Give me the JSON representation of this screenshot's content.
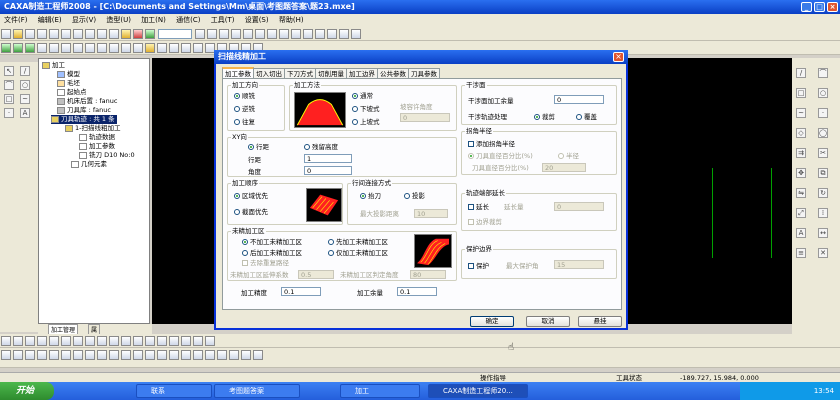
{
  "app": {
    "title": "CAXA制造工程师2008 - [C:\\Documents and Settings\\Mm\\桌面\\考图题答案\\题23.mxe]"
  },
  "menu": [
    "文件(F)",
    "编辑(E)",
    "显示(V)",
    "造型(U)",
    "加工(N)",
    "通信(C)",
    "工具(T)",
    "设置(S)",
    "帮助(H)"
  ],
  "tree": {
    "items": [
      "加工",
      "模型",
      "毛坯",
      "起始点",
      "机床后置 : fanuc",
      "刀具库 : fanuc",
      "刀具轨迹 : 共 1 条",
      "1-扫描线粗加工",
      "轨迹数据",
      "加工参数",
      "铣刀 D10 No:0",
      "几何元素"
    ]
  },
  "bottom_tabs": [
    "加工管理",
    "属"
  ],
  "status": {
    "prompt": "操作指导",
    "tool_state": "工具状态",
    "coords": "-189.727, 15.984, 0.000"
  },
  "taskbar": {
    "start": "开始",
    "tasks": [
      "联系",
      "考图题答案",
      "加工",
      "CAXA制造工程师20..."
    ],
    "clock": "13:54"
  },
  "dialog": {
    "title": "扫描线精加工",
    "tabs": [
      "加工参数",
      "切入切出",
      "下刀方式",
      "切削用量",
      "加工边界",
      "公共参数",
      "刀具参数"
    ],
    "machining_direction": {
      "title": "加工方向",
      "options": [
        "顺铣",
        "逆铣",
        "往复"
      ]
    },
    "machining_method": {
      "title": "加工方法",
      "options": [
        "通常",
        "下坡式",
        "上坡式"
      ],
      "slope_angle_label": "坡容许角度",
      "slope_angle_value": "0"
    },
    "xy": {
      "title": "XY向",
      "options": [
        "行距",
        "残留高度"
      ],
      "step_label": "行距",
      "step_value": "1",
      "angle_label": "角度",
      "angle_value": "0"
    },
    "order": {
      "title": "加工顺序",
      "options": [
        "区域优先",
        "截面优先"
      ]
    },
    "connect": {
      "title": "行间连接方式",
      "options": [
        "抬刀",
        "投影"
      ],
      "max_dist_label": "最大投影距离",
      "max_dist_value": "10"
    },
    "unmachined": {
      "title": "未精加工区",
      "options": [
        "不加工未精加工区",
        "先加工未精加工区",
        "后加工未精加工区",
        "仅加工未精加工区"
      ],
      "remove_label": "去除重复路径",
      "extend_label": "未精加工区延伸系数",
      "extend_value": "0.5",
      "judge_label": "未精加工区判定角度",
      "judge_value": "80"
    },
    "precision_label": "加工精度",
    "precision_value": "0.1",
    "allowance_label": "加工余量",
    "allowance_value": "0.1",
    "interference": {
      "title": "干涉面",
      "allowance_label": "干涉面加工余量",
      "allowance_value": "0",
      "handle_label": "干涉轨迹处理",
      "options": [
        "裁剪",
        "覆盖"
      ]
    },
    "corner": {
      "title": "拐角半径",
      "add_label": "添加拐角半径",
      "options": [
        "刀具直径百分比(%)",
        "半径"
      ],
      "pct_label": "刀具直径百分比(%)",
      "pct_value": "20"
    },
    "extend": {
      "title": "轨迹端部延长",
      "check_label": "延长",
      "len_label": "延长量",
      "len_value": "0",
      "boundary_label": "边界裁剪"
    },
    "protect": {
      "title": "保护边界",
      "check_label": "保护",
      "angle_label": "最大保护角",
      "angle_value": "15"
    },
    "buttons": {
      "ok": "确定",
      "cancel": "取消",
      "hang": "悬挂"
    }
  },
  "colors": {
    "accent": "#0a3fc4",
    "canvas": "#000000",
    "preview_red": "#ff2020"
  }
}
